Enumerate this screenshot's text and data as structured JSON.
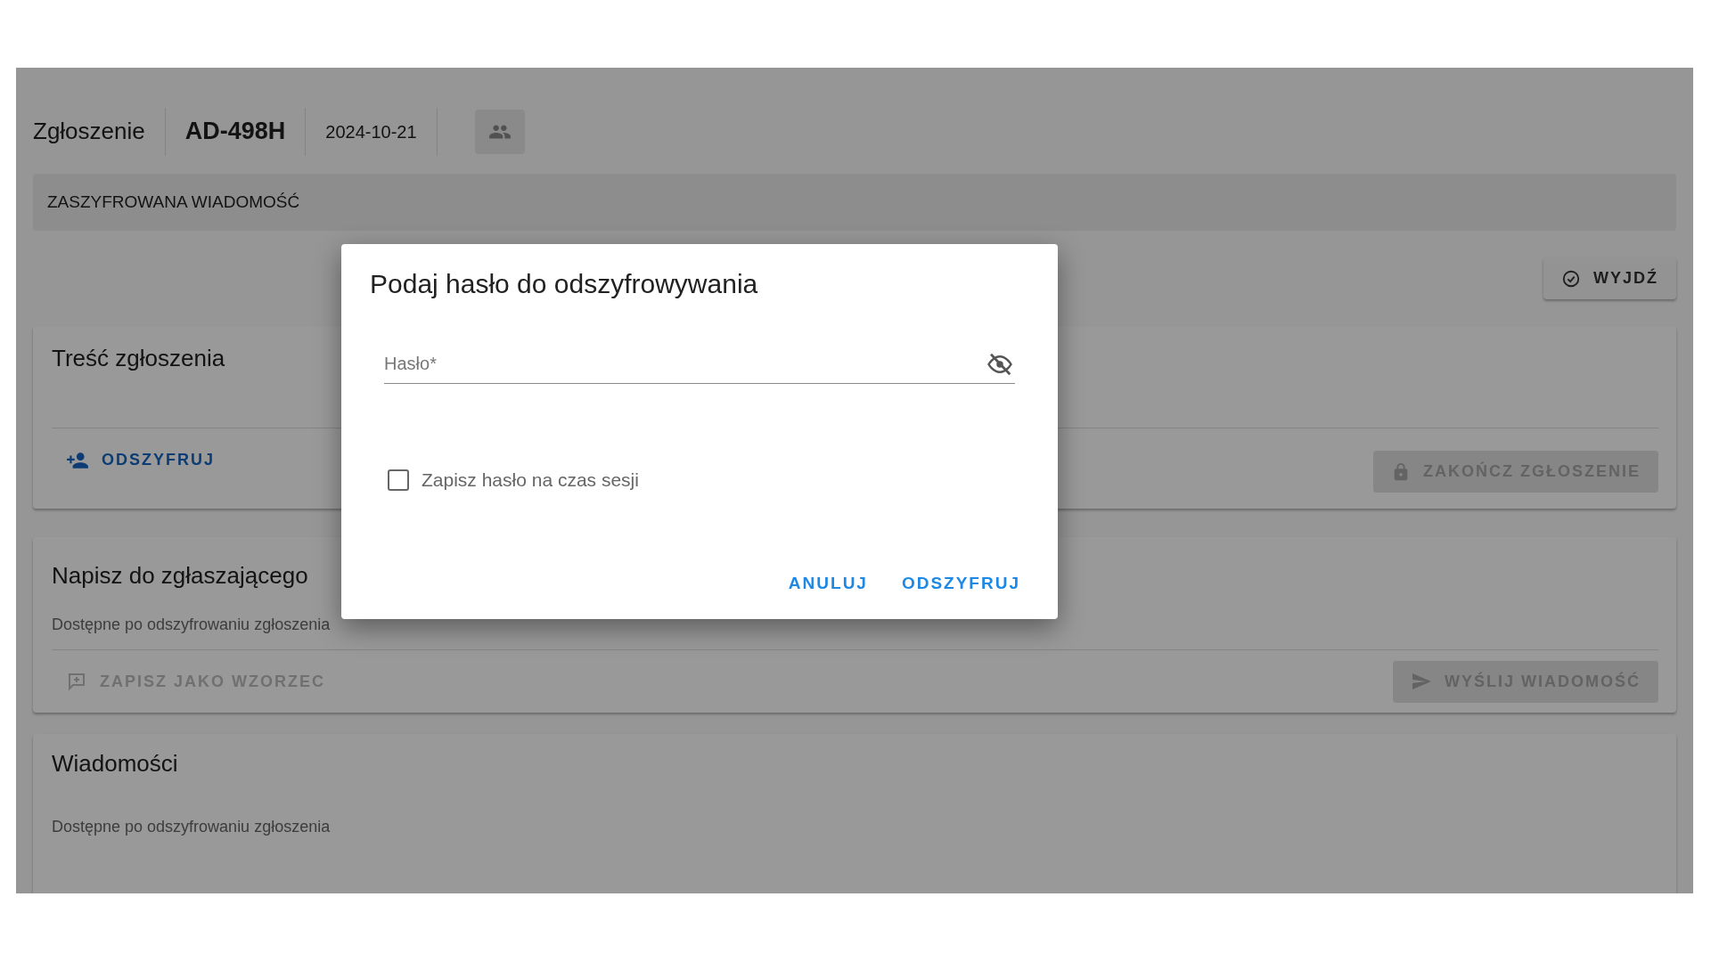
{
  "header": {
    "label": "Zgłoszenie",
    "ticket_id": "AD-498H",
    "date": "2024-10-21"
  },
  "banner": "ZASZYFROWANA WIADOMOŚĆ",
  "exit_button": {
    "label": "WYJDŹ"
  },
  "content_card": {
    "title": "Treść zgłoszenia",
    "decrypt_link": "ODSZYFRUJ",
    "close_button": {
      "label": "ZAKOŃCZ ZGŁOSZENIE",
      "disabled": true
    }
  },
  "message_card": {
    "title": "Napisz do zgłaszającego",
    "note": "Dostępne po odszyfrowaniu zgłoszenia",
    "template_button": {
      "label": "ZAPISZ JAKO WZORZEC",
      "disabled": true
    },
    "send_button": {
      "label": "WYŚLIJ WIADOMOŚĆ",
      "disabled": true
    }
  },
  "messages_card": {
    "title": "Wiadomości",
    "note": "Dostępne po odszyfrowaniu zgłoszenia"
  },
  "dialog": {
    "title": "Podaj hasło do odszyfrowywania",
    "password_field": {
      "placeholder": "Hasło*"
    },
    "remember_checkbox": {
      "label": "Zapisz hasło na czas sesji",
      "checked": false
    },
    "buttons": [
      {
        "label": "ANULUJ"
      },
      {
        "label": "ODSZYFRUJ"
      }
    ]
  }
}
